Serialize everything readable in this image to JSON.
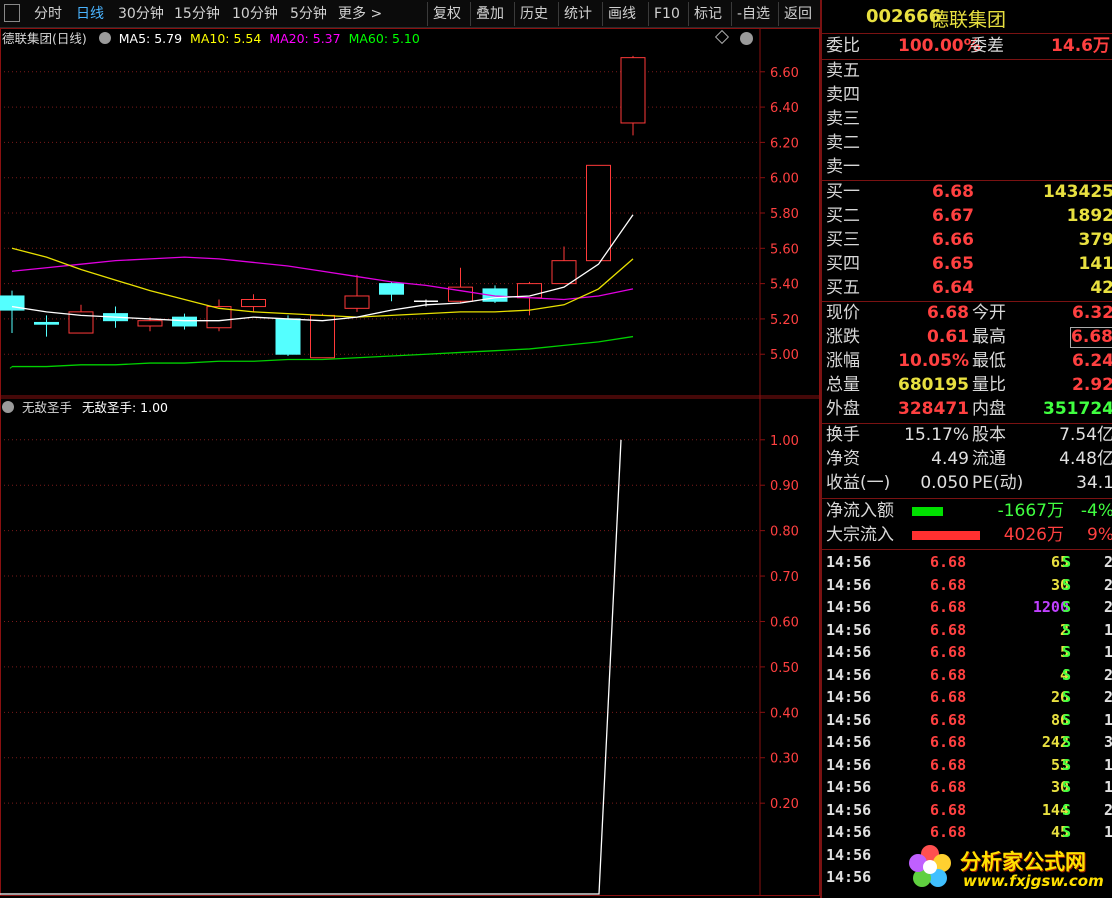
{
  "toolbar": {
    "periods": [
      "分时",
      "日线",
      "30分钟",
      "15分钟",
      "10分钟",
      "5分钟",
      "更多 >"
    ],
    "active_period": "日线",
    "buttons": [
      "复权",
      "叠加",
      "历史",
      "统计",
      "画线",
      "F10",
      "标记",
      "-自选",
      "返回"
    ]
  },
  "main_chart": {
    "title": "德联集团(日线)",
    "ma_legend": [
      {
        "label": "MA5: 5.79",
        "color": "#ffffff"
      },
      {
        "label": "MA10: 5.54",
        "color": "#ffff00"
      },
      {
        "label": "MA20: 5.37",
        "color": "#ff00ff"
      },
      {
        "label": "MA60: 5.10",
        "color": "#00ff00"
      }
    ],
    "y_axis": [
      "6.60",
      "6.40",
      "6.20",
      "6.00",
      "5.80",
      "5.60",
      "5.40",
      "5.20",
      "5.00"
    ]
  },
  "indicator": {
    "name": "无敌圣手",
    "legend": "无敌圣手: 1.00",
    "y_axis": [
      "1.00",
      "0.90",
      "0.80",
      "0.70",
      "0.60",
      "0.50",
      "0.40",
      "0.30",
      "0.20"
    ]
  },
  "chart_data": {
    "type": "candlestick",
    "y_range": [
      4.82,
      6.78
    ],
    "candles": [
      {
        "o": 5.25,
        "h": 5.36,
        "l": 5.12,
        "c": 5.33,
        "color": "cyan"
      },
      {
        "o": 5.18,
        "h": 5.22,
        "l": 5.1,
        "c": 5.17,
        "color": "cyan"
      },
      {
        "o": 5.12,
        "h": 5.28,
        "l": 5.12,
        "c": 5.24,
        "color": "red"
      },
      {
        "o": 5.23,
        "h": 5.27,
        "l": 5.15,
        "c": 5.19,
        "color": "cyan"
      },
      {
        "o": 5.16,
        "h": 5.21,
        "l": 5.13,
        "c": 5.19,
        "color": "red"
      },
      {
        "o": 5.21,
        "h": 5.23,
        "l": 5.14,
        "c": 5.16,
        "color": "cyan"
      },
      {
        "o": 5.15,
        "h": 5.31,
        "l": 5.13,
        "c": 5.27,
        "color": "red"
      },
      {
        "o": 5.27,
        "h": 5.34,
        "l": 5.24,
        "c": 5.31,
        "color": "red"
      },
      {
        "o": 5.2,
        "h": 5.22,
        "l": 4.99,
        "c": 5.0,
        "color": "cyan"
      },
      {
        "o": 4.98,
        "h": 5.23,
        "l": 4.98,
        "c": 5.22,
        "color": "red"
      },
      {
        "o": 5.26,
        "h": 5.45,
        "l": 5.24,
        "c": 5.33,
        "color": "red"
      },
      {
        "o": 5.4,
        "h": 5.41,
        "l": 5.3,
        "c": 5.34,
        "color": "cyan"
      },
      {
        "o": 5.3,
        "h": 5.31,
        "l": 5.27,
        "c": 5.3,
        "color": "white"
      },
      {
        "o": 5.3,
        "h": 5.49,
        "l": 5.29,
        "c": 5.38,
        "color": "red"
      },
      {
        "o": 5.37,
        "h": 5.39,
        "l": 5.29,
        "c": 5.3,
        "color": "cyan"
      },
      {
        "o": 5.32,
        "h": 5.41,
        "l": 5.22,
        "c": 5.4,
        "color": "red"
      },
      {
        "o": 5.4,
        "h": 5.61,
        "l": 5.4,
        "c": 5.53,
        "color": "red"
      },
      {
        "o": 5.53,
        "h": 6.07,
        "l": 5.53,
        "c": 6.07,
        "color": "red"
      },
      {
        "o": 6.31,
        "h": 6.69,
        "l": 6.24,
        "c": 6.68,
        "color": "red"
      }
    ],
    "ma5": [
      5.27,
      5.24,
      5.22,
      5.21,
      5.2,
      5.19,
      5.19,
      5.21,
      5.2,
      5.19,
      5.21,
      5.25,
      5.28,
      5.29,
      5.32,
      5.33,
      5.38,
      5.51,
      5.79
    ],
    "ma10": [
      5.6,
      5.55,
      5.48,
      5.42,
      5.36,
      5.31,
      5.26,
      5.24,
      5.23,
      5.22,
      5.21,
      5.22,
      5.23,
      5.24,
      5.24,
      5.25,
      5.28,
      5.37,
      5.54
    ],
    "ma20": [
      5.47,
      5.49,
      5.51,
      5.53,
      5.54,
      5.55,
      5.54,
      5.52,
      5.5,
      5.47,
      5.44,
      5.41,
      5.39,
      5.36,
      5.33,
      5.32,
      5.31,
      5.33,
      5.37
    ],
    "ma60": [
      4.93,
      4.93,
      4.94,
      4.94,
      4.95,
      4.95,
      4.96,
      4.96,
      4.97,
      4.97,
      4.98,
      4.99,
      5.0,
      5.01,
      5.02,
      5.03,
      5.05,
      5.07,
      5.1
    ],
    "indicator_values": [
      0,
      0,
      0,
      0,
      0,
      0,
      0,
      0,
      0,
      0,
      0,
      0,
      0,
      0,
      0,
      0,
      0,
      0,
      1.0
    ],
    "indicator_range": [
      0,
      1.07
    ]
  },
  "quote": {
    "code": "002666",
    "name": "德联集团",
    "wei_bi_label": "委比",
    "wei_bi": "100.00%",
    "wei_cha_label": "委差",
    "wei_cha": "14.6万",
    "sell": [
      {
        "label": "卖五",
        "price": "",
        "vol": ""
      },
      {
        "label": "卖四",
        "price": "",
        "vol": ""
      },
      {
        "label": "卖三",
        "price": "",
        "vol": ""
      },
      {
        "label": "卖二",
        "price": "",
        "vol": ""
      },
      {
        "label": "卖一",
        "price": "",
        "vol": ""
      }
    ],
    "buy": [
      {
        "label": "买一",
        "price": "6.68",
        "vol": "143425"
      },
      {
        "label": "买二",
        "price": "6.67",
        "vol": "1892"
      },
      {
        "label": "买三",
        "price": "6.66",
        "vol": "379"
      },
      {
        "label": "买四",
        "price": "6.65",
        "vol": "141"
      },
      {
        "label": "买五",
        "price": "6.64",
        "vol": "42"
      }
    ],
    "stats": [
      {
        "l1": "现价",
        "v1": "6.68",
        "c1": "#ff4040",
        "l2": "今开",
        "v2": "6.32",
        "c2": "#ff4040"
      },
      {
        "l1": "涨跌",
        "v1": "0.61",
        "c1": "#ff4040",
        "l2": "最高",
        "v2": "6.68",
        "c2": "#ff4040"
      },
      {
        "l1": "涨幅",
        "v1": "10.05%",
        "c1": "#ff4040",
        "l2": "最低",
        "v2": "6.24",
        "c2": "#ff4040"
      },
      {
        "l1": "总量",
        "v1": "680195",
        "c1": "#e8e040",
        "l2": "量比",
        "v2": "2.92",
        "c2": "#ff4040"
      },
      {
        "l1": "外盘",
        "v1": "328471",
        "c1": "#ff4040",
        "l2": "内盘",
        "v2": "351724",
        "c2": "#40ff40"
      }
    ],
    "fin": [
      {
        "l1": "换手",
        "v1": "15.17%",
        "l2": "股本",
        "v2": "7.54亿"
      },
      {
        "l1": "净资",
        "v1": "4.49",
        "l2": "流通",
        "v2": "4.48亿"
      },
      {
        "l1": "收益(一)",
        "v1": "0.050",
        "l2": "PE(动)",
        "v2": "34.1"
      }
    ],
    "flow": [
      {
        "label": "净流入额",
        "value": "-1667万",
        "pct": "-4%",
        "bar_color": "#00e000",
        "value_color": "#40ff40",
        "bar_fraction": 0.45
      },
      {
        "label": "大宗流入",
        "value": "4026万",
        "pct": "9%",
        "bar_color": "#ff3030",
        "value_color": "#ff4040",
        "bar_fraction": 1.0
      }
    ],
    "ticks": [
      {
        "time": "14:56",
        "price": "6.68",
        "vol": "65",
        "side": "S",
        "n": "2"
      },
      {
        "time": "14:56",
        "price": "6.68",
        "vol": "30",
        "side": "S",
        "n": "2"
      },
      {
        "time": "14:56",
        "price": "6.68",
        "vol": "1200",
        "side": "S",
        "n": "2",
        "purple": true
      },
      {
        "time": "14:56",
        "price": "6.68",
        "vol": "2",
        "side": "S",
        "n": "1"
      },
      {
        "time": "14:56",
        "price": "6.68",
        "vol": "5",
        "side": "S",
        "n": "1"
      },
      {
        "time": "14:56",
        "price": "6.68",
        "vol": "4",
        "side": "S",
        "n": "2"
      },
      {
        "time": "14:56",
        "price": "6.68",
        "vol": "26",
        "side": "S",
        "n": "2"
      },
      {
        "time": "14:56",
        "price": "6.68",
        "vol": "86",
        "side": "S",
        "n": "1"
      },
      {
        "time": "14:56",
        "price": "6.68",
        "vol": "242",
        "side": "S",
        "n": "3"
      },
      {
        "time": "14:56",
        "price": "6.68",
        "vol": "53",
        "side": "S",
        "n": "1"
      },
      {
        "time": "14:56",
        "price": "6.68",
        "vol": "30",
        "side": "S",
        "n": "1"
      },
      {
        "time": "14:56",
        "price": "6.68",
        "vol": "144",
        "side": "S",
        "n": "2"
      },
      {
        "time": "14:56",
        "price": "6.68",
        "vol": "45",
        "side": "S",
        "n": "1"
      },
      {
        "time": "14:56",
        "price": "",
        "vol": "",
        "side": "",
        "n": ""
      },
      {
        "time": "14:56",
        "price": "",
        "vol": "",
        "side": "",
        "n": ""
      }
    ]
  },
  "watermark": {
    "title": "分析家公式网",
    "url": "www.fxjgsw.com"
  },
  "colors": {
    "up": "#ff3a3a",
    "down": "#54ffff",
    "frame": "#8a1010",
    "grid": "#7a1a1a"
  }
}
